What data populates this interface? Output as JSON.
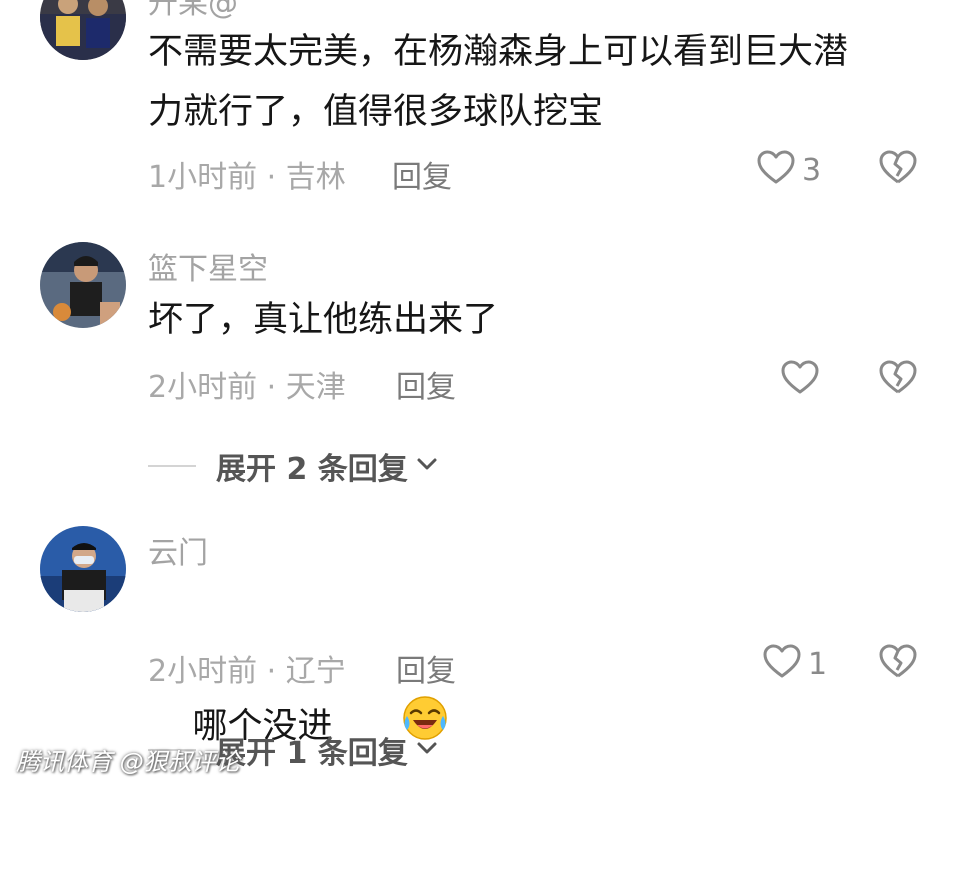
{
  "comments": [
    {
      "username": "升某@",
      "content": "不需要太完美，在杨瀚森身上可以看到巨大潜\n力就行了，值得很多球队挖宝",
      "meta": "1小时前 · 吉林",
      "reply_label": "回复",
      "like_count": "3"
    },
    {
      "username": "篮下星空",
      "content": "坏了，真让他练出来了",
      "meta": "2小时前 · 天津",
      "reply_label": "回复",
      "like_count": "",
      "expand_label": "展开 2 条回复"
    },
    {
      "username": "云门",
      "content": "哪个没进",
      "meta": "2小时前 · 辽宁",
      "reply_label": "回复",
      "like_count": "1",
      "expand_label": "展开 1 条回复"
    }
  ],
  "watermark": "腾讯体育 @狠叔评论",
  "icons": {
    "like": "heart-outline-icon",
    "dislike": "broken-heart-outline-icon",
    "expand": "chevron-down-icon",
    "emoji": "laughing-crying-emoji"
  },
  "colors": {
    "text_primary": "#161616",
    "text_secondary": "#a3a3a3",
    "icon": "#8a8a8a"
  }
}
